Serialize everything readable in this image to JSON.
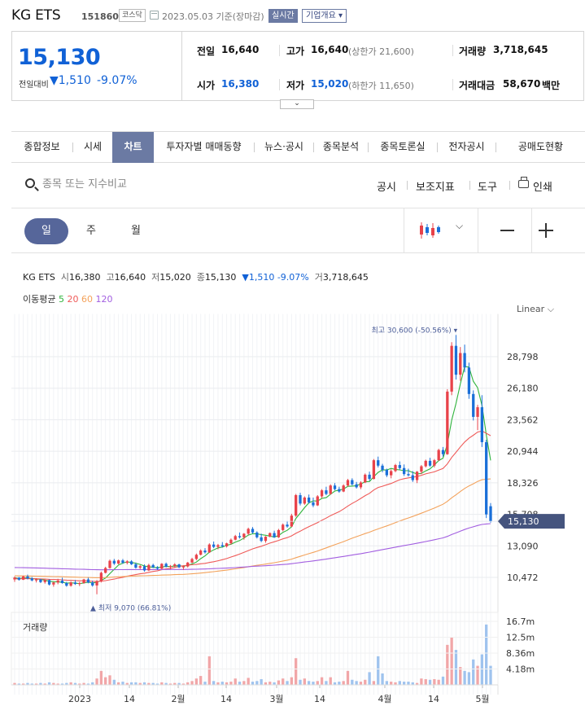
{
  "header": {
    "name": "KG ETS",
    "code": "151860",
    "market": "코스닥",
    "base_date": "2023.05.03 기준(장마감)",
    "realtime_label": "실시간",
    "overview_label": "기업개요 ▾"
  },
  "quote": {
    "price": "15,130",
    "change_label": "전일대비",
    "change_value": "▼1,510",
    "change_pct": "-9.07%",
    "prev_label": "전일",
    "prev": "16,640",
    "high_label": "고가",
    "high": "16,640",
    "upper_limit": "(상한가 21,600)",
    "volume_label": "거래량",
    "volume": "3,718,645",
    "open_label": "시가",
    "open": "16,380",
    "low_label": "저가",
    "low": "15,020",
    "lower_limit": "(하한가 11,650)",
    "amount_label": "거래대금",
    "amount": "58,670",
    "amount_unit": "백만"
  },
  "tabs": [
    "종합정보",
    "시세",
    "차트",
    "투자자별 매매동향",
    "뉴스·공시",
    "종목분석",
    "종목토론실",
    "전자공시",
    "공매도현황"
  ],
  "active_tab": "차트",
  "toolbar": {
    "search_placeholder": "종목 또는 지수비교",
    "disclosure": "공시",
    "indicators": "보조지표",
    "tools": "도구",
    "print": "인쇄"
  },
  "period": {
    "day": "일",
    "week": "주",
    "month": "월",
    "active": "일"
  },
  "info": {
    "name": "KG ETS",
    "open_l": "시",
    "open": "16,380",
    "high_l": "고",
    "high": "16,640",
    "low_l": "저",
    "low": "15,020",
    "close_l": "종",
    "close": "15,130",
    "change": "▼1,510 -9.07%",
    "vol_l": "거",
    "vol": "3,718,645"
  },
  "ma": {
    "label": "이동평균",
    "p5": "5",
    "p20": "20",
    "p60": "60",
    "p120": "120"
  },
  "scale_mode": "Linear",
  "chart_data": {
    "type": "candlestick",
    "price_ticks": [
      "28,798",
      "26,180",
      "23,562",
      "20,944",
      "18,326",
      "15,708",
      "13,090",
      "10,472"
    ],
    "current_price_tag": "15,130",
    "max_annotation": "최고 30,600 (-50.56%)",
    "min_annotation": "최저 9,070 (66.81%)",
    "x_ticks": [
      "2023",
      "14",
      "2월",
      "14",
      "3월",
      "14",
      "4월",
      "14",
      "5월"
    ],
    "volume_label": "거래량",
    "volume_ticks": [
      "16.7m",
      "12.5m",
      "8.36m",
      "4.18m"
    ],
    "colors": {
      "up": "#e8424a",
      "down": "#1a6fd8",
      "ma5": "#2fb43c",
      "ma20": "#ef5a58",
      "ma60": "#f3a25b",
      "ma120": "#a25ee0"
    },
    "candles": [
      [
        10300,
        10550,
        10100,
        10450
      ],
      [
        10450,
        10500,
        10200,
        10280
      ],
      [
        10280,
        10600,
        10250,
        10550
      ],
      [
        10550,
        10700,
        10300,
        10380
      ],
      [
        10380,
        10500,
        10150,
        10220
      ],
      [
        10220,
        10400,
        10050,
        10300
      ],
      [
        10300,
        10350,
        10000,
        10080
      ],
      [
        10080,
        10300,
        9950,
        10250
      ],
      [
        10250,
        10300,
        9800,
        9880
      ],
      [
        9880,
        10100,
        9700,
        10050
      ],
      [
        10050,
        10350,
        9900,
        10200
      ],
      [
        10200,
        10450,
        9950,
        10000
      ],
      [
        10000,
        10100,
        9700,
        9780
      ],
      [
        9780,
        10150,
        9700,
        10050
      ],
      [
        10050,
        10250,
        9850,
        9920
      ],
      [
        9920,
        10100,
        9750,
        10000
      ],
      [
        10000,
        10350,
        9950,
        10300
      ],
      [
        10300,
        10450,
        9980,
        10050
      ],
      [
        10050,
        10200,
        9700,
        9800
      ],
      [
        9800,
        10250,
        9070,
        10150
      ],
      [
        10150,
        10950,
        10050,
        10850
      ],
      [
        10850,
        11350,
        10800,
        11250
      ],
      [
        11250,
        11950,
        11200,
        11850
      ],
      [
        11850,
        12000,
        11500,
        11620
      ],
      [
        11620,
        11950,
        11550,
        11880
      ],
      [
        11880,
        12000,
        11600,
        11680
      ],
      [
        11680,
        11900,
        11550,
        11800
      ],
      [
        11800,
        11900,
        11500,
        11560
      ],
      [
        11560,
        11700,
        11200,
        11280
      ],
      [
        11280,
        11500,
        11150,
        11400
      ],
      [
        11400,
        11550,
        10950,
        11050
      ],
      [
        11050,
        11600,
        11000,
        11500
      ],
      [
        11500,
        11600,
        11250,
        11300
      ],
      [
        11300,
        11400,
        11100,
        11200
      ],
      [
        11200,
        11650,
        11150,
        11600
      ],
      [
        11600,
        11700,
        11300,
        11350
      ],
      [
        11350,
        11500,
        11150,
        11420
      ],
      [
        11420,
        11650,
        11300,
        11550
      ],
      [
        11550,
        11600,
        11250,
        11300
      ],
      [
        11300,
        11450,
        11100,
        11380
      ],
      [
        11380,
        11750,
        11300,
        11700
      ],
      [
        11700,
        12100,
        11650,
        12000
      ],
      [
        12000,
        12450,
        11900,
        12350
      ],
      [
        12350,
        12800,
        12300,
        12700
      ],
      [
        12700,
        12900,
        12450,
        12550
      ],
      [
        12550,
        13300,
        12500,
        13200
      ],
      [
        13200,
        13450,
        12900,
        13000
      ],
      [
        13000,
        13250,
        12800,
        13150
      ],
      [
        13150,
        13400,
        12950,
        13050
      ],
      [
        13050,
        13350,
        12950,
        13300
      ],
      [
        13300,
        13700,
        13200,
        13600
      ],
      [
        13600,
        14000,
        13550,
        13900
      ],
      [
        13900,
        14200,
        13700,
        13800
      ],
      [
        13800,
        14150,
        13600,
        14100
      ],
      [
        14100,
        14600,
        14000,
        14500
      ],
      [
        14500,
        14650,
        14100,
        14200
      ],
      [
        14200,
        14300,
        13700,
        13800
      ],
      [
        13800,
        14100,
        13400,
        13500
      ],
      [
        13500,
        13900,
        13350,
        13850
      ],
      [
        13850,
        14200,
        13800,
        14150
      ],
      [
        14150,
        14350,
        13750,
        13800
      ],
      [
        13800,
        14500,
        13750,
        14400
      ],
      [
        14400,
        14950,
        14300,
        14850
      ],
      [
        14850,
        15150,
        14600,
        14700
      ],
      [
        14700,
        15750,
        14650,
        15600
      ],
      [
        15600,
        17400,
        15500,
        17300
      ],
      [
        17300,
        17500,
        16450,
        16600
      ],
      [
        16600,
        17200,
        16500,
        17100
      ],
      [
        17100,
        17350,
        16600,
        16700
      ],
      [
        16700,
        17100,
        16300,
        16450
      ],
      [
        16450,
        17300,
        16400,
        17200
      ],
      [
        17200,
        17800,
        17050,
        17700
      ],
      [
        17700,
        18000,
        17300,
        17400
      ],
      [
        17400,
        18200,
        17350,
        18100
      ],
      [
        18100,
        18300,
        17700,
        17800
      ],
      [
        17800,
        18000,
        17500,
        17600
      ],
      [
        17600,
        18200,
        17550,
        18100
      ],
      [
        18100,
        18650,
        18000,
        18550
      ],
      [
        18550,
        18700,
        18100,
        18200
      ],
      [
        18200,
        18400,
        17850,
        17950
      ],
      [
        17950,
        18450,
        17800,
        18350
      ],
      [
        18350,
        19100,
        18300,
        19000
      ],
      [
        19000,
        19250,
        18500,
        18650
      ],
      [
        18650,
        20300,
        18600,
        20200
      ],
      [
        20200,
        20500,
        19600,
        19750
      ],
      [
        19750,
        19900,
        19200,
        19400
      ],
      [
        19400,
        19500,
        18800,
        18950
      ],
      [
        18950,
        19450,
        18700,
        19300
      ],
      [
        19300,
        19900,
        19200,
        19800
      ],
      [
        19800,
        20100,
        19400,
        19550
      ],
      [
        19550,
        19850,
        18900,
        19050
      ],
      [
        19050,
        19500,
        18850,
        18950
      ],
      [
        18950,
        19300,
        18400,
        18550
      ],
      [
        18550,
        19300,
        18300,
        19250
      ],
      [
        19250,
        19800,
        19050,
        19700
      ],
      [
        19700,
        20250,
        19600,
        20150
      ],
      [
        20150,
        20400,
        19650,
        19750
      ],
      [
        19750,
        20300,
        19600,
        20200
      ],
      [
        20200,
        21150,
        20150,
        21050
      ],
      [
        21050,
        21300,
        20500,
        20700
      ],
      [
        20700,
        26100,
        20650,
        25900
      ],
      [
        25900,
        30000,
        25600,
        29700
      ],
      [
        29700,
        30600,
        26900,
        27300
      ],
      [
        27300,
        29600,
        26800,
        29100
      ],
      [
        29100,
        29800,
        27500,
        27900
      ],
      [
        27900,
        28300,
        25300,
        25700
      ],
      [
        25700,
        26000,
        23500,
        23800
      ],
      [
        23800,
        24800,
        22700,
        24600
      ],
      [
        24600,
        25600,
        21300,
        21700
      ],
      [
        21700,
        21900,
        15400,
        15700
      ],
      [
        16380,
        16640,
        15020,
        15130
      ]
    ],
    "volume_ratio": [
      0.03,
      0.02,
      0.02,
      0.03,
      0.02,
      0.02,
      0.03,
      0.02,
      0.04,
      0.03,
      0.02,
      0.02,
      0.03,
      0.04,
      0.03,
      0.02,
      0.03,
      0.02,
      0.04,
      0.1,
      0.22,
      0.12,
      0.15,
      0.08,
      0.04,
      0.05,
      0.03,
      0.04,
      0.04,
      0.03,
      0.04,
      0.03,
      0.03,
      0.02,
      0.04,
      0.03,
      0.02,
      0.03,
      0.03,
      0.02,
      0.04,
      0.06,
      0.1,
      0.14,
      0.05,
      0.45,
      0.06,
      0.04,
      0.05,
      0.04,
      0.05,
      0.1,
      0.05,
      0.06,
      0.11,
      0.05,
      0.06,
      0.09,
      0.04,
      0.05,
      0.04,
      0.07,
      0.1,
      0.06,
      0.12,
      0.42,
      0.08,
      0.1,
      0.06,
      0.05,
      0.06,
      0.12,
      0.06,
      0.12,
      0.04,
      0.05,
      0.06,
      0.22,
      0.08,
      0.06,
      0.05,
      0.08,
      0.2,
      0.06,
      0.45,
      0.18,
      0.06,
      0.05,
      0.04,
      0.06,
      0.05,
      0.05,
      0.04,
      0.03,
      0.1,
      0.09,
      0.08,
      0.09,
      0.08,
      0.13,
      0.63,
      0.75,
      0.55,
      0.28,
      0.22,
      0.2,
      0.4,
      0.3,
      0.48,
      0.95,
      0.3
    ]
  }
}
